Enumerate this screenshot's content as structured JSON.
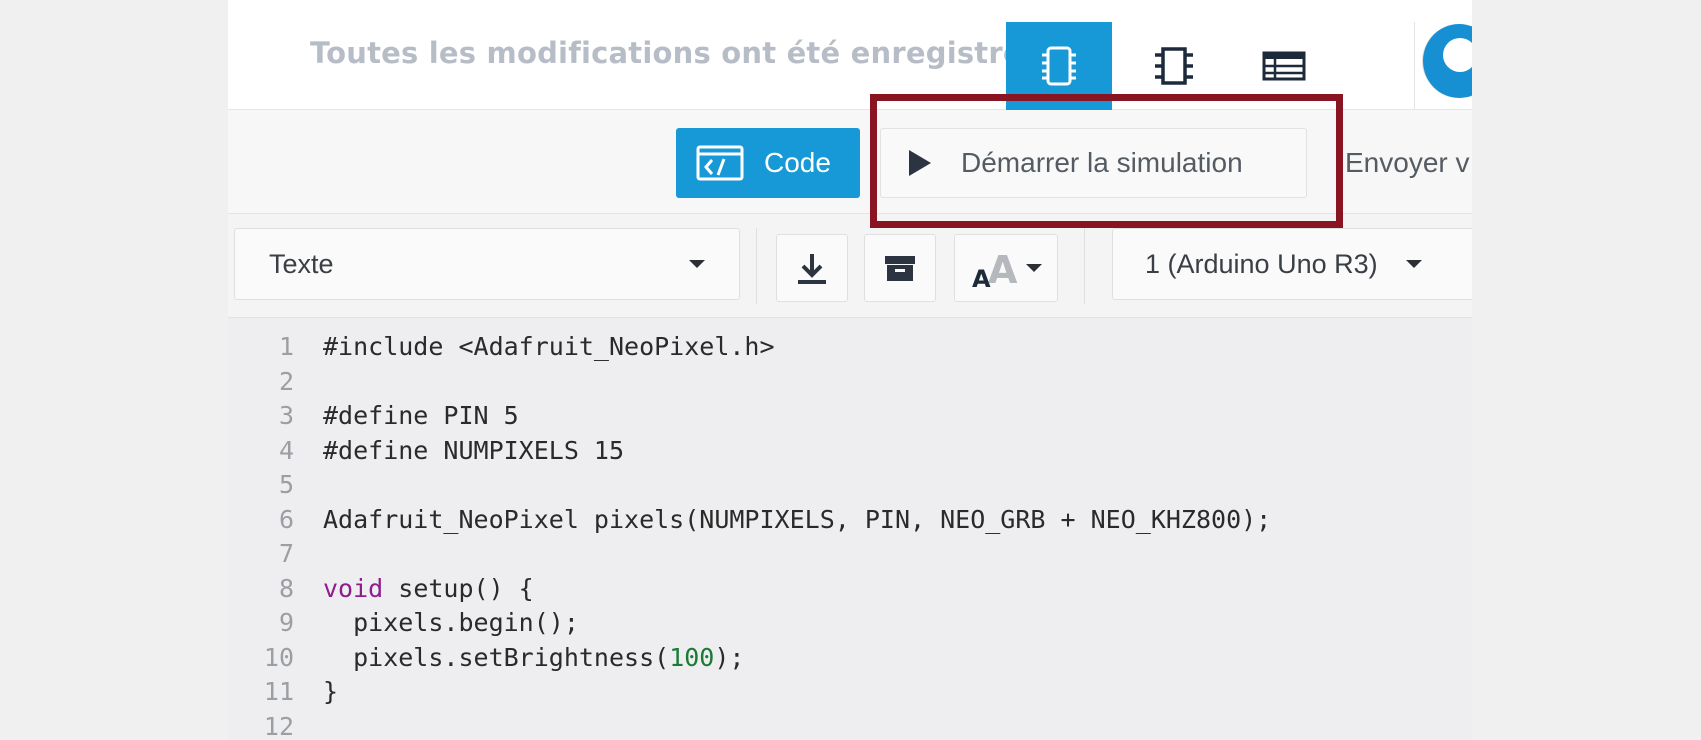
{
  "topbar": {
    "saved_status": "Toutes les modifications ont été enregistrées",
    "views": [
      {
        "icon": "circuit-view-icon",
        "active": true
      },
      {
        "icon": "chip-icon",
        "active": false
      },
      {
        "icon": "table-list-icon",
        "active": false
      }
    ],
    "avatar": "user-avatar"
  },
  "actions": {
    "code_label": "Code",
    "simulate_label": "Démarrer la simulation",
    "send_label": "Envoyer v"
  },
  "editor_toolbar": {
    "mode_value": "Texte",
    "board_value": "1 (Arduino Uno R3)",
    "tools": [
      "download-icon",
      "library-icon",
      "font-size-icon"
    ]
  },
  "code": {
    "line_numbers": [
      "1",
      "2",
      "3",
      "4",
      "5",
      "6",
      "7",
      "8",
      "9",
      "10",
      "11",
      "12"
    ],
    "lines": [
      "#include <Adafruit_NeoPixel.h>",
      "",
      "#define PIN 5",
      "#define NUMPIXELS 15",
      "",
      "Adafruit_NeoPixel pixels(NUMPIXELS, PIN, NEO_GRB + NEO_KHZ800);",
      "",
      "void setup() {",
      "  pixels.begin();",
      "  pixels.setBrightness(100);",
      "}",
      ""
    ]
  },
  "colors": {
    "accent": "#1799d7",
    "highlight": "#8a1522",
    "keyword": "#8e1d8e",
    "number": "#1a7a36"
  }
}
